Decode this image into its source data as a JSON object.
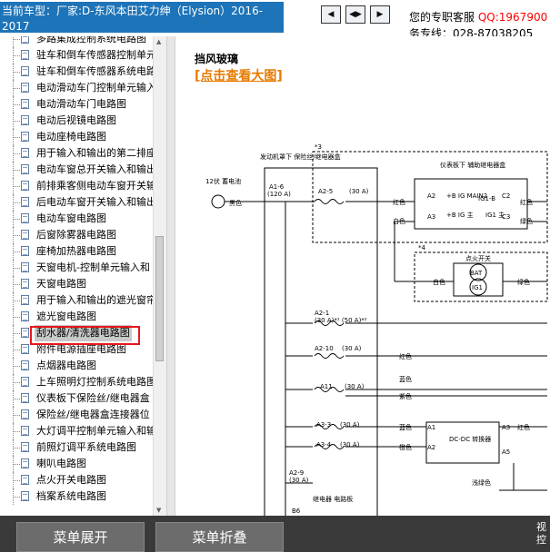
{
  "header": {
    "model_label": "当前车型：厂家:D-东风本田艾力绅（Elysion）2016-2017",
    "support_label": "您的专职客服",
    "qq": "QQ:1967900",
    "hotline": "务专线：028-87038205",
    "nav_buttons": [
      "◀",
      "◀▶",
      "▶"
    ]
  },
  "tree": {
    "items": [
      "多路集成控制系统电路图",
      "驻车和倒车传感器控制单元",
      "驻车和倒车传感器系统电路",
      "电动滑动车门控制单元输入",
      "电动滑动车门电路图",
      "电动后视镜电路图",
      "电动座椅电路图",
      "用于输入和输出的第二排座",
      "电动车窗总开关输入和输出",
      "前排乘客侧电动车窗开关输",
      "后电动车窗开关输入和输出",
      "电动车窗电路图",
      "后窗除雾器电路图",
      "座椅加热器电路图",
      "天窗电机-控制单元输入和",
      "天窗电路图",
      "用于输入和输出的遮光窗帘",
      "遮光窗电路图",
      "刮水器/清洗器电路图",
      "附件电源插座电路图",
      "点烟器电路图",
      "上车照明灯控制系统电路图",
      "仪表板下保险丝/继电器盒",
      "保险丝/继电器盒连接器位",
      "大灯调平控制单元输入和输",
      "前照灯调平系统电路图",
      "喇叭电路图",
      "点火开关电路图",
      "档案系统电路图"
    ],
    "selected_index": 18
  },
  "content": {
    "title": "挡风玻璃",
    "big_link": "[点击查看大图]"
  },
  "diagram": {
    "battery": "12伏\n蓄电池",
    "fusebox": "发动机罩下\n保险丝/继电器盒",
    "star3": "*3",
    "star4": "*4",
    "fuse_a16": "A1-6",
    "fuse_a16_amp": "(120 A)",
    "fuse_a25": "A2-5",
    "fuse_a25_amp": "(30 A)",
    "fuse_a21": "A2-1",
    "fuse_a21_amp": "(30 A)*¹ (50 A)*²",
    "fuse_a210": "A2-10",
    "fuse_a210_amp": "(30 A)",
    "fuse_a11": "A11",
    "fuse_a11_amp": "(30 A)",
    "fuse_a33": "A3-3",
    "fuse_a33_amp": "(30 A)",
    "fuse_a34": "A3-4",
    "fuse_a34_amp": "(30 A)",
    "fuse_a29": "A2-9",
    "fuse_a29_amp": "(30 A)",
    "dash_box": "仪表板下\n辅助继电器盒",
    "dash_main2": "+B IG\nMAIN2",
    "dash_ig1b": "IG1-B",
    "dash_ig": "+B IG\n主",
    "dash_ig1": "IG1\n主",
    "ign": "点火开关",
    "bat": "BAT",
    "ig1": "IG1",
    "dcdc": "DC-DC\n转换器",
    "relay_box": "继电器\n电路板",
    "b6": "B6",
    "pin_a2": "A2",
    "pin_a3": "A3",
    "pin_a1": "A1",
    "pin_c2": "C2",
    "pin_c3": "C3",
    "pin_a5": "A5",
    "c_black": "黑色",
    "c_red": "红色",
    "c_white": "白色",
    "c_green": "绿色",
    "c_blue": "蓝色",
    "c_orange": "橙色",
    "c_purple": "紫色",
    "c_lightgreen": "浅绿色"
  },
  "bottom": {
    "expand": "菜单展开",
    "collapse": "菜单折叠",
    "side": "视控"
  }
}
